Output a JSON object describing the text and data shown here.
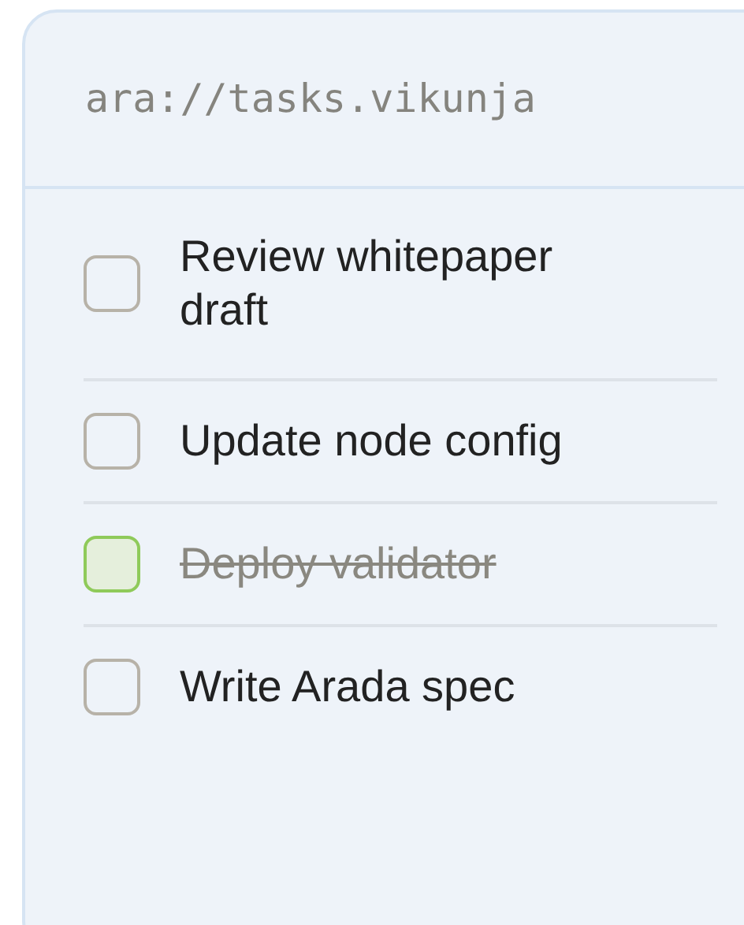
{
  "header": {
    "address": "ara://tasks.vikunja"
  },
  "tasks": [
    {
      "title": "Review whitepaper draft",
      "checked": false
    },
    {
      "title": "Update node config",
      "checked": false
    },
    {
      "title": "Deploy validator",
      "checked": true
    },
    {
      "title": "Write Arada spec",
      "checked": false
    }
  ]
}
